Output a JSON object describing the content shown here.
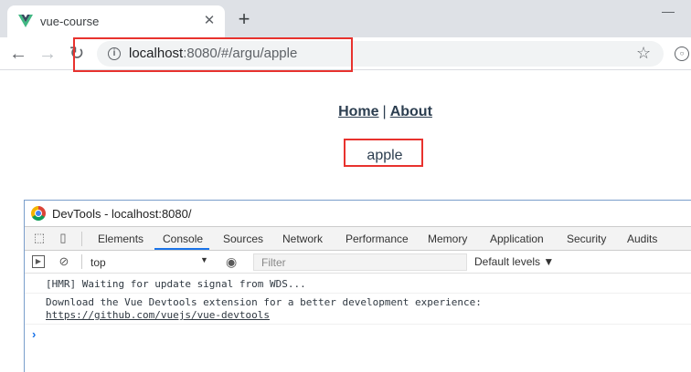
{
  "browser": {
    "tab_title": "vue-course",
    "new_tab_symbol": "+",
    "url_host": "localhost",
    "url_rest": ":8080/#/argu/apple"
  },
  "page": {
    "nav_home": "Home",
    "nav_separator": "|",
    "nav_about": "About",
    "content_text": "apple"
  },
  "devtools": {
    "window_title": "DevTools - localhost:8080/",
    "tabs": [
      "Elements",
      "Console",
      "Sources",
      "Network",
      "Performance",
      "Memory",
      "Application",
      "Security",
      "Audits"
    ],
    "active_tab": "Console",
    "context": "top",
    "filter_placeholder": "Filter",
    "levels": "Default levels ▼",
    "messages": [
      "[HMR] Waiting for update signal from WDS...",
      "Download the Vue Devtools extension for a better development experience:"
    ],
    "link": "https://github.com/vuejs/vue-devtools",
    "prompt": "›"
  },
  "colors": {
    "highlight": "#e8322e",
    "link_text": "#2c3e50",
    "active_tab_underline": "#1a73e8"
  }
}
